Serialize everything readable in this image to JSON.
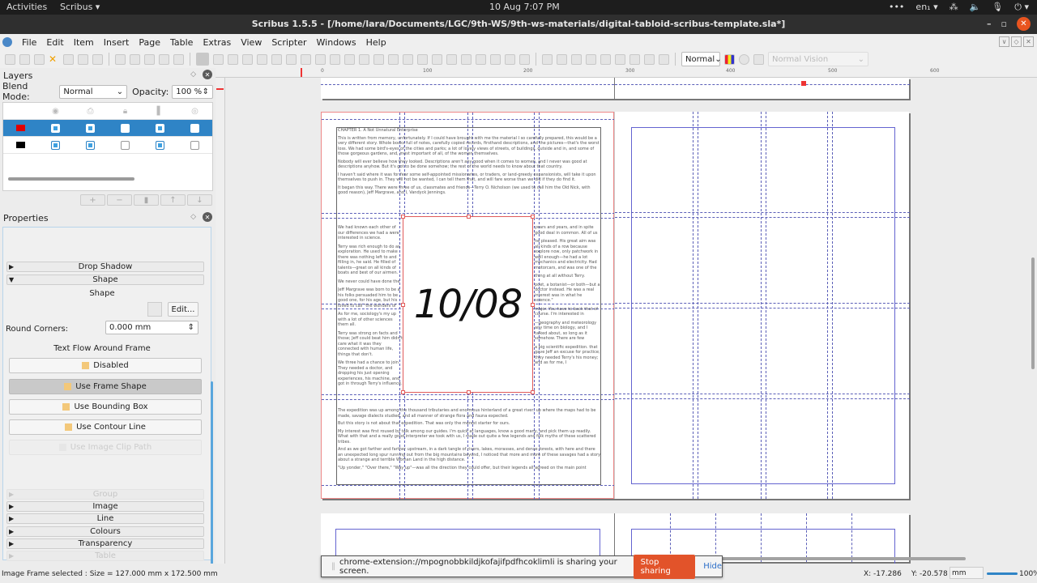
{
  "system_bar": {
    "activities": "Activities",
    "app_menu": "Scribus ▾",
    "date_time": "10 Aug  7:07 PM",
    "tray": [
      "•••",
      "en₁ ▾",
      "⁂",
      "🔈",
      "🎙",
      "⏻ ▾"
    ]
  },
  "window": {
    "title": "Scribus 1.5.5 - [/home/lara/Documents/LGC/9th-WS/9th-ws-materials/digital-tabloid-scribus-template.sla*]",
    "minimize": "–",
    "restore": "▫",
    "close": "✕"
  },
  "menu": [
    "File",
    "Edit",
    "Item",
    "Insert",
    "Page",
    "Table",
    "Extras",
    "View",
    "Scripter",
    "Windows",
    "Help"
  ],
  "toolbar": {
    "mode_select": "Normal",
    "vision_select": "Normal Vision"
  },
  "layers_panel": {
    "title": "Layers",
    "blend_mode_label": "Blend Mode:",
    "blend_mode_value": "Normal",
    "opacity_label": "Opacity:",
    "opacity_value": "100 %",
    "column_icons": [
      "",
      "eye-icon",
      "print-icon",
      "lock-icon",
      "flow-icon",
      "outline-icon"
    ],
    "rows": [
      {
        "color": "#e00000",
        "selected": true,
        "visible": true,
        "print": true,
        "locked": false,
        "flow": true,
        "outline": false
      },
      {
        "color": "#000000",
        "selected": false,
        "visible": true,
        "print": true,
        "locked": false,
        "flow": true,
        "outline": false
      }
    ],
    "buttons": [
      "+",
      "−",
      "▮",
      "↑",
      "↓"
    ]
  },
  "properties_panel": {
    "title": "Properties",
    "sections_top": [
      {
        "label": "Drop Shadow",
        "expanded": false
      },
      {
        "label": "Shape",
        "expanded": true
      }
    ],
    "shape_heading": "Shape",
    "edit_button": "Edit...",
    "round_corners_label": "Round Corners:",
    "round_corners_value": "0.000 mm",
    "text_flow_heading": "Text Flow Around Frame",
    "text_flow_options": [
      {
        "label": "Disabled",
        "active": false,
        "enabled": true
      },
      {
        "label": "Use Frame Shape",
        "active": true,
        "enabled": true
      },
      {
        "label": "Use Bounding Box",
        "active": false,
        "enabled": true
      },
      {
        "label": "Use Contour Line",
        "active": false,
        "enabled": true
      },
      {
        "label": "Use Image Clip Path",
        "active": false,
        "enabled": false
      }
    ],
    "sections_bottom": [
      {
        "label": "Group",
        "enabled": false
      },
      {
        "label": "Image",
        "enabled": true
      },
      {
        "label": "Line",
        "enabled": true
      },
      {
        "label": "Colours",
        "enabled": true
      },
      {
        "label": "Transparency",
        "enabled": true
      },
      {
        "label": "Table",
        "enabled": false
      }
    ]
  },
  "ruler": {
    "ticks": [
      "0",
      "100",
      "200",
      "300",
      "400",
      "500",
      "600"
    ]
  },
  "document": {
    "image_frame_text": "10/08",
    "chapter_title": "CHAPTER 1. A Not Unnatural Enterprise",
    "paragraphs_top": [
      "This is written from memory, unfortunately. If I could have brought with me the material I so carefully prepared, this would be a very different story. Whole books full of notes, carefully copied records, firsthand descriptions, and the pictures—that's the worst loss. We had some bird's-eyes of the cities and parks; a lot of lovely views of streets, of buildings, outside and in, and some of those gorgeous gardens, and, most important of all, of the women themselves.",
      "Nobody will ever believe how they looked. Descriptions aren't any good when it comes to women, and I never was good at descriptions anyhow. But it's got to be done somehow; the rest of the world needs to know about that country.",
      "I haven't said where it was for fear some self-appointed missionaries, or traders, or land-greedy expansionists, will take it upon themselves to push in. They will not be wanted, I can tell them that, and will fare worse than we did if they do find it.",
      "It began this way. There were three of us, classmates and friends—Terry O. Nicholson (we used to call him the Old Nick, with good reason), Jeff Margrave, and I, Vandyck Jennings."
    ],
    "left_col": [
      "We had known each other of our differences we had a were interested in science.",
      "Terry was rich enough to do as exploration. He used to make there was nothing left to and filling in, he said. He filled of talents—great on all kinds of boats and best of our airmen.",
      "We never could have done the",
      "Jeff Margrave was born to be a his folks persuaded him to be good one, for his age, but his loved to call \"the wonders of",
      "As for me, sociology's my up with a lot of other sciences them all.",
      "Terry was strong on facts and those; Jeff could beat him didn't care what it was they connected with human life, things that don't.",
      "We three had a chance to join They needed a doctor, and dropping his just opening experiences, his machine, and got in through Terry's influence."
    ],
    "right_col": [
      "years and years, and in spite good deal in common. All of us",
      "he pleased. His great aim was all kinds of a row because explore now, only patchwork in well enough—he had a lot mechanics and electricity. Had motorcars, and was one of the",
      "thing at all without Terry.",
      "poet, a botanist—or both—but a doctor instead. He was a real interest was in what he science.\"",
      "major. You have to back that of course. I'm interested in",
      "—geography and meteorology any time on biology, and I talked about, so long as it somehow. There are few",
      "a big scientific expedition. that gave Jeff an excuse for practice; they needed Terry's his money; and as for me, I"
    ],
    "paragraphs_bottom": [
      "The expedition was up among the thousand tributaries and enormous hinterland of a great river, up where the maps had to be made, savage dialects studied, and all manner of strange flora and fauna expected.",
      "But this story is not about that expedition. That was only the merest starter for ours.",
      "My interest was first roused by talk among our guides. I'm quick at languages, know a good many, and pick them up readily. What with that and a really good interpreter we took with us, I made out quite a few legends and folk myths of these scattered tribes.",
      "And as we got farther and farther upstream, in a dark tangle of rivers, lakes, morasses, and dense forests, with here and there an unexpected long spur running out from the big mountains beyond, I noticed that more and more of these savages had a story about a strange and terrible Woman Land in the high distance.",
      "\"Up yonder,\" \"Over there,\" \"Way up\"—was all the direction they could offer, but their legends all agreed on the main point"
    ]
  },
  "screen_share": {
    "message": "chrome-extension://mpognobbkildjkofajifpdfhcoklimli is sharing your screen.",
    "stop_label": "Stop sharing",
    "hide_label": "Hide"
  },
  "status_bar": {
    "message": "Image Frame selected : Size = 127.000 mm x 172.500 mm",
    "x_coord": "X: -17.286",
    "y_coord": "Y: -20.578",
    "unit": "mm",
    "zoom": "100%"
  },
  "colors": {
    "accent": "#2f84c6",
    "stop_sharing": "#e2532a",
    "selection_frame": "#e05a5a",
    "guides": "#5b5fb8"
  }
}
